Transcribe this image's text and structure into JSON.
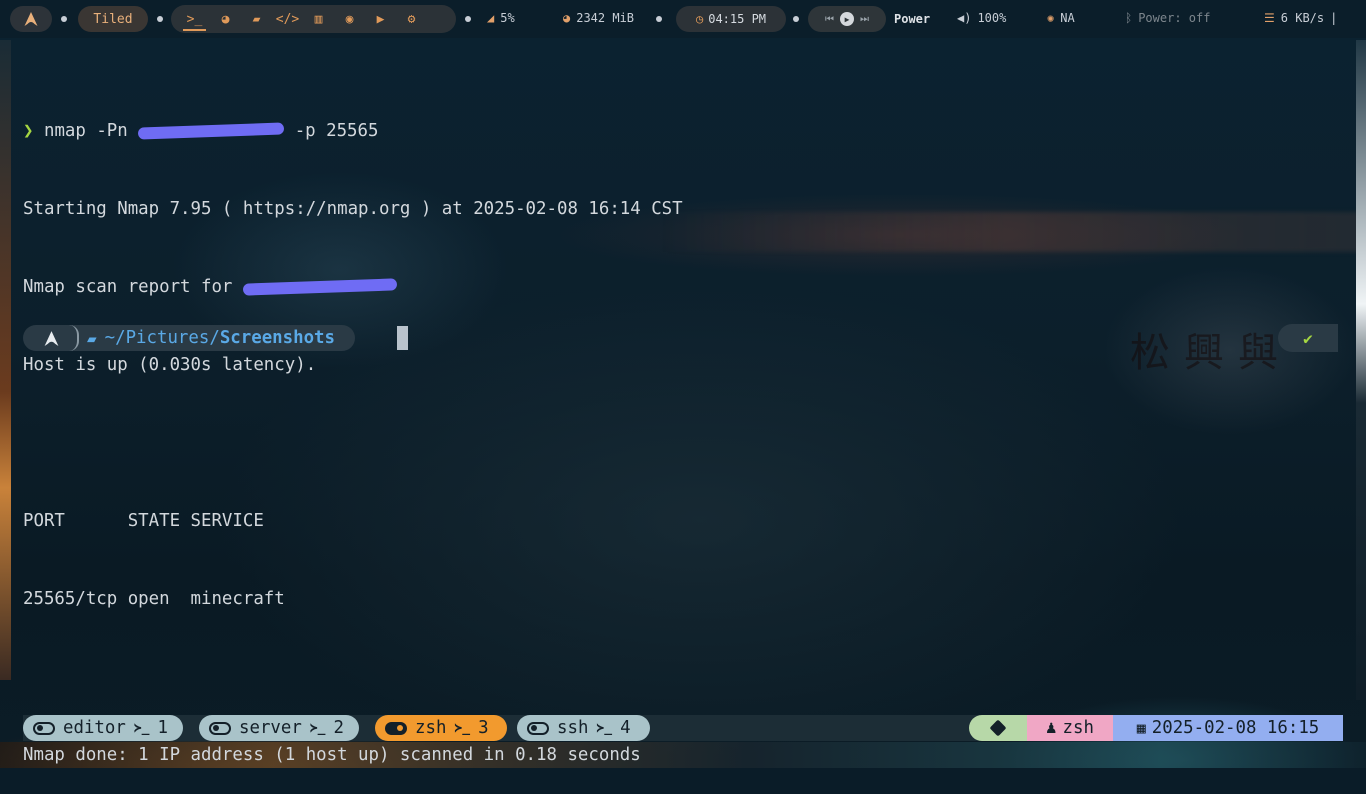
{
  "topbar": {
    "layout_mode": "Tiled",
    "apps": [
      {
        "name": "terminal-icon",
        "glyph": "╱"
      },
      {
        "name": "firefox-icon",
        "glyph": "●"
      },
      {
        "name": "folder-icon",
        "glyph": "▤"
      },
      {
        "name": "code-icon",
        "glyph": "</>"
      },
      {
        "name": "book-icon",
        "glyph": "▥"
      },
      {
        "name": "chat-icon",
        "glyph": "◉"
      },
      {
        "name": "youtube-icon",
        "glyph": "▶"
      },
      {
        "name": "settings-icon",
        "glyph": "⚙"
      }
    ],
    "cpu": "5%",
    "memory": "2342 MiB",
    "clock": "04:15 PM",
    "power_label": "Power",
    "volume": "100%",
    "brightness": "NA",
    "bluetooth": "Power: off",
    "network": "6 KB/s",
    "separator": "|",
    "accent_color": "#e09a5a"
  },
  "terminal": {
    "prompt_symbol": "❯",
    "command_prefix": "nmap -Pn",
    "command_suffix": "-p 25565",
    "output_line_1": "Starting Nmap 7.95 ( https://nmap.org ) at 2025-02-08 16:14 CST",
    "output_line_2_prefix": "Nmap scan report for",
    "output_line_3": "Host is up (0.030s latency).",
    "table_header": "PORT      STATE SERVICE",
    "table_row": "25565/tcp open  minecraft",
    "summary": "Nmap done: 1 IP address (1 host up) scanned in 0.18 seconds",
    "prompt_path_prefix": "~/Pictures/",
    "prompt_path_dir": "Screenshots",
    "status_ok": "✔"
  },
  "bottombar": {
    "windows": [
      {
        "name": "editor",
        "index": "1",
        "active": false
      },
      {
        "name": "server",
        "index": "2",
        "active": false
      },
      {
        "name": "zsh",
        "index": "3",
        "active": true
      },
      {
        "name": "ssh",
        "index": "4",
        "active": false
      }
    ],
    "shell_symbol": "≻_",
    "current_shell": "zsh",
    "datetime": "2025-02-08 16:15"
  }
}
